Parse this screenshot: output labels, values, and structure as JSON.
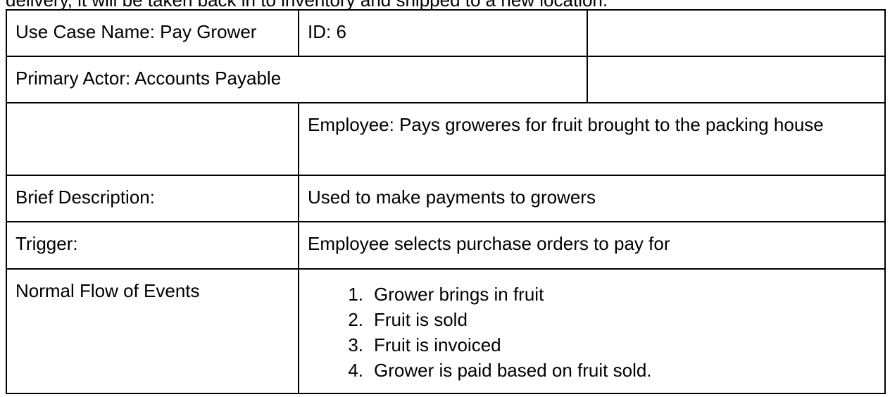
{
  "intro_text": "delivery, it will be taken back in to inventory and shipped to a new location.",
  "use_case": {
    "name_label": "Use Case Name: Pay Grower",
    "id_label": "ID: 6",
    "primary_actor": "Primary Actor: Accounts Payable",
    "stakeholder": "Employee: Pays groweres for fruit brought to the packing house",
    "brief_description_label": "Brief Description:",
    "brief_description": "Used to make payments to growers",
    "trigger_label": "Trigger:",
    "trigger": "Employee selects purchase orders to pay for",
    "normal_flow_label": "Normal Flow of Events",
    "normal_flow": [
      {
        "num": "1.",
        "text": "Grower brings in fruit"
      },
      {
        "num": "2.",
        "text": "Fruit is sold"
      },
      {
        "num": "3.",
        "text": "Fruit is invoiced"
      },
      {
        "num": "4.",
        "text": "Grower is paid based on fruit sold."
      }
    ]
  }
}
